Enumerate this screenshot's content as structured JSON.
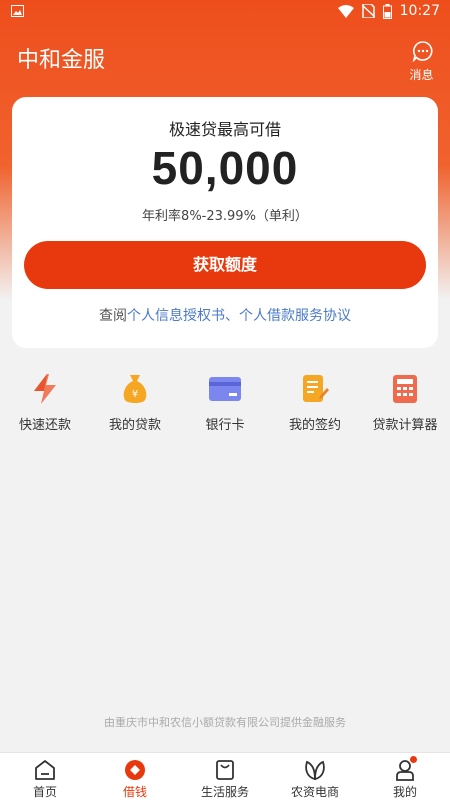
{
  "status_bar": {
    "time": "10:27"
  },
  "header": {
    "title": "中和金服",
    "message_label": "消息"
  },
  "loan_card": {
    "title": "极速贷最高可借",
    "amount": "50,000",
    "rate": "年利率8%-23.99%（单利）",
    "apply_label": "获取额度",
    "agreement_prefix": "查阅",
    "agreement_links": "个人信息授权书、个人借款服务协议"
  },
  "shortcuts": [
    {
      "label": "快速还款",
      "icon": "lightning-icon"
    },
    {
      "label": "我的贷款",
      "icon": "money-bag-icon"
    },
    {
      "label": "银行卡",
      "icon": "bank-card-icon"
    },
    {
      "label": "我的签约",
      "icon": "contract-icon"
    },
    {
      "label": "贷款计算器",
      "icon": "calculator-icon"
    }
  ],
  "footer_note": "由重庆市中和农信小额贷款有限公司提供金融服务",
  "bottom_nav": [
    {
      "label": "首页",
      "icon": "home-icon"
    },
    {
      "label": "借钱",
      "icon": "borrow-icon",
      "active": true
    },
    {
      "label": "生活服务",
      "icon": "shopping-bag-icon"
    },
    {
      "label": "农资电商",
      "icon": "leaf-icon"
    },
    {
      "label": "我的",
      "icon": "user-icon",
      "badge": true
    }
  ],
  "colors": {
    "brand": "#e8390e",
    "link": "#4b7bc8"
  }
}
